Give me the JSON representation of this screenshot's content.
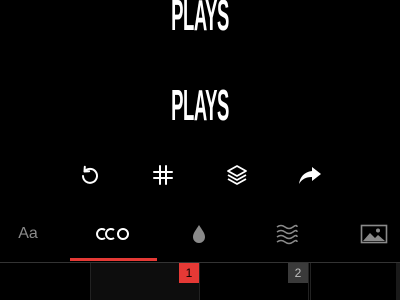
{
  "preview": {
    "top_text": "PLAYS",
    "middle_text": "PLAYS"
  },
  "toolbar": {
    "tools": [
      {
        "name": "undo",
        "icon": "undo-icon"
      },
      {
        "name": "grid",
        "icon": "grid-icon"
      },
      {
        "name": "layers",
        "icon": "layers-icon"
      },
      {
        "name": "share",
        "icon": "share-icon"
      }
    ]
  },
  "tabs": {
    "items": [
      {
        "label": "Aa",
        "icon": "font-icon"
      },
      {
        "label": "cco",
        "icon": "text-style-icon",
        "active": true
      },
      {
        "label": "",
        "icon": "color-drop-icon"
      },
      {
        "label": "",
        "icon": "texture-waves-icon"
      },
      {
        "label": "",
        "icon": "image-icon"
      }
    ]
  },
  "timeline": {
    "slots": [
      {
        "number": "1",
        "active": true
      },
      {
        "number": "2",
        "active": false
      }
    ]
  },
  "colors": {
    "background": "#000000",
    "accent": "#e53935",
    "inactive_icon": "#8a8a8a"
  }
}
